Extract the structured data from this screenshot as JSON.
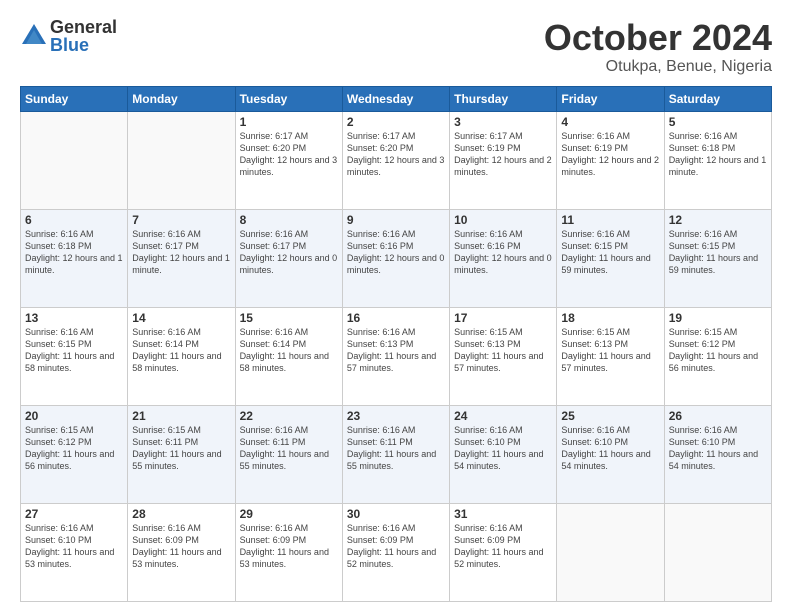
{
  "header": {
    "logo_general": "General",
    "logo_blue": "Blue",
    "title": "October 2024",
    "location": "Otukpa, Benue, Nigeria"
  },
  "weekdays": [
    "Sunday",
    "Monday",
    "Tuesday",
    "Wednesday",
    "Thursday",
    "Friday",
    "Saturday"
  ],
  "weeks": [
    [
      {
        "day": "",
        "info": ""
      },
      {
        "day": "",
        "info": ""
      },
      {
        "day": "1",
        "info": "Sunrise: 6:17 AM\nSunset: 6:20 PM\nDaylight: 12 hours and 3 minutes."
      },
      {
        "day": "2",
        "info": "Sunrise: 6:17 AM\nSunset: 6:20 PM\nDaylight: 12 hours and 3 minutes."
      },
      {
        "day": "3",
        "info": "Sunrise: 6:17 AM\nSunset: 6:19 PM\nDaylight: 12 hours and 2 minutes."
      },
      {
        "day": "4",
        "info": "Sunrise: 6:16 AM\nSunset: 6:19 PM\nDaylight: 12 hours and 2 minutes."
      },
      {
        "day": "5",
        "info": "Sunrise: 6:16 AM\nSunset: 6:18 PM\nDaylight: 12 hours and 1 minute."
      }
    ],
    [
      {
        "day": "6",
        "info": "Sunrise: 6:16 AM\nSunset: 6:18 PM\nDaylight: 12 hours and 1 minute."
      },
      {
        "day": "7",
        "info": "Sunrise: 6:16 AM\nSunset: 6:17 PM\nDaylight: 12 hours and 1 minute."
      },
      {
        "day": "8",
        "info": "Sunrise: 6:16 AM\nSunset: 6:17 PM\nDaylight: 12 hours and 0 minutes."
      },
      {
        "day": "9",
        "info": "Sunrise: 6:16 AM\nSunset: 6:16 PM\nDaylight: 12 hours and 0 minutes."
      },
      {
        "day": "10",
        "info": "Sunrise: 6:16 AM\nSunset: 6:16 PM\nDaylight: 12 hours and 0 minutes."
      },
      {
        "day": "11",
        "info": "Sunrise: 6:16 AM\nSunset: 6:15 PM\nDaylight: 11 hours and 59 minutes."
      },
      {
        "day": "12",
        "info": "Sunrise: 6:16 AM\nSunset: 6:15 PM\nDaylight: 11 hours and 59 minutes."
      }
    ],
    [
      {
        "day": "13",
        "info": "Sunrise: 6:16 AM\nSunset: 6:15 PM\nDaylight: 11 hours and 58 minutes."
      },
      {
        "day": "14",
        "info": "Sunrise: 6:16 AM\nSunset: 6:14 PM\nDaylight: 11 hours and 58 minutes."
      },
      {
        "day": "15",
        "info": "Sunrise: 6:16 AM\nSunset: 6:14 PM\nDaylight: 11 hours and 58 minutes."
      },
      {
        "day": "16",
        "info": "Sunrise: 6:16 AM\nSunset: 6:13 PM\nDaylight: 11 hours and 57 minutes."
      },
      {
        "day": "17",
        "info": "Sunrise: 6:15 AM\nSunset: 6:13 PM\nDaylight: 11 hours and 57 minutes."
      },
      {
        "day": "18",
        "info": "Sunrise: 6:15 AM\nSunset: 6:13 PM\nDaylight: 11 hours and 57 minutes."
      },
      {
        "day": "19",
        "info": "Sunrise: 6:15 AM\nSunset: 6:12 PM\nDaylight: 11 hours and 56 minutes."
      }
    ],
    [
      {
        "day": "20",
        "info": "Sunrise: 6:15 AM\nSunset: 6:12 PM\nDaylight: 11 hours and 56 minutes."
      },
      {
        "day": "21",
        "info": "Sunrise: 6:15 AM\nSunset: 6:11 PM\nDaylight: 11 hours and 55 minutes."
      },
      {
        "day": "22",
        "info": "Sunrise: 6:16 AM\nSunset: 6:11 PM\nDaylight: 11 hours and 55 minutes."
      },
      {
        "day": "23",
        "info": "Sunrise: 6:16 AM\nSunset: 6:11 PM\nDaylight: 11 hours and 55 minutes."
      },
      {
        "day": "24",
        "info": "Sunrise: 6:16 AM\nSunset: 6:10 PM\nDaylight: 11 hours and 54 minutes."
      },
      {
        "day": "25",
        "info": "Sunrise: 6:16 AM\nSunset: 6:10 PM\nDaylight: 11 hours and 54 minutes."
      },
      {
        "day": "26",
        "info": "Sunrise: 6:16 AM\nSunset: 6:10 PM\nDaylight: 11 hours and 54 minutes."
      }
    ],
    [
      {
        "day": "27",
        "info": "Sunrise: 6:16 AM\nSunset: 6:10 PM\nDaylight: 11 hours and 53 minutes."
      },
      {
        "day": "28",
        "info": "Sunrise: 6:16 AM\nSunset: 6:09 PM\nDaylight: 11 hours and 53 minutes."
      },
      {
        "day": "29",
        "info": "Sunrise: 6:16 AM\nSunset: 6:09 PM\nDaylight: 11 hours and 53 minutes."
      },
      {
        "day": "30",
        "info": "Sunrise: 6:16 AM\nSunset: 6:09 PM\nDaylight: 11 hours and 52 minutes."
      },
      {
        "day": "31",
        "info": "Sunrise: 6:16 AM\nSunset: 6:09 PM\nDaylight: 11 hours and 52 minutes."
      },
      {
        "day": "",
        "info": ""
      },
      {
        "day": "",
        "info": ""
      }
    ]
  ]
}
